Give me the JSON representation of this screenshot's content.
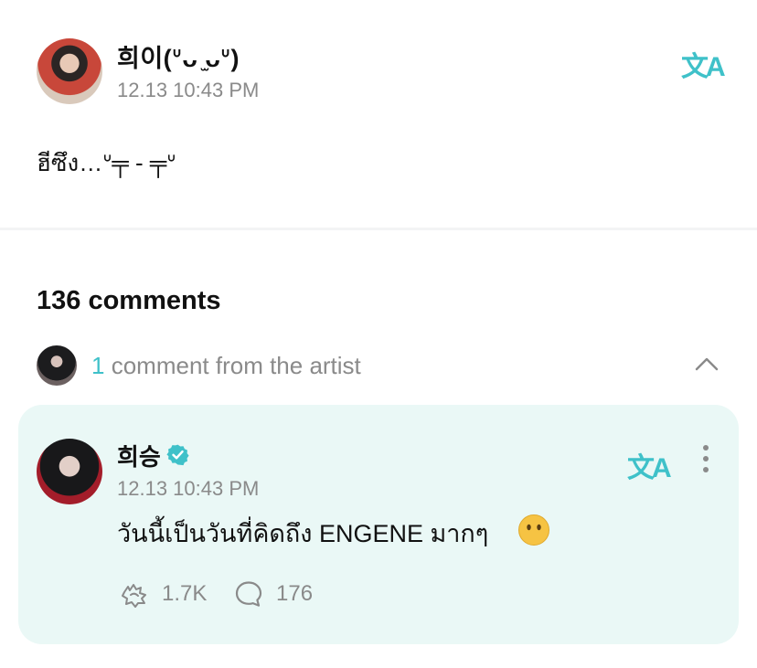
{
  "post": {
    "author": "희이(ᐡᴗ ̫ᴗᐡ)",
    "time": "12.13 10:43 PM",
    "body": "ฮีซึง…ᐡ╤ - ╤ᐡ",
    "translate_icon": "translate-icon"
  },
  "comments": {
    "count_label": "136 comments",
    "artist_count": "1",
    "artist_text": "comment from the artist"
  },
  "artist_comment": {
    "author": "희승",
    "verified_icon": "verified-badge-icon",
    "time": "12.13 10:43 PM",
    "body": "วันนี้เป็นวันที่คิดถึง ENGENE มากๆ",
    "emoji": "😶",
    "likes": "1.7K",
    "replies": "176"
  },
  "colors": {
    "accent": "#3fc1c9",
    "card_bg": "#eaf8f6",
    "muted_text": "#8a8a8a"
  }
}
